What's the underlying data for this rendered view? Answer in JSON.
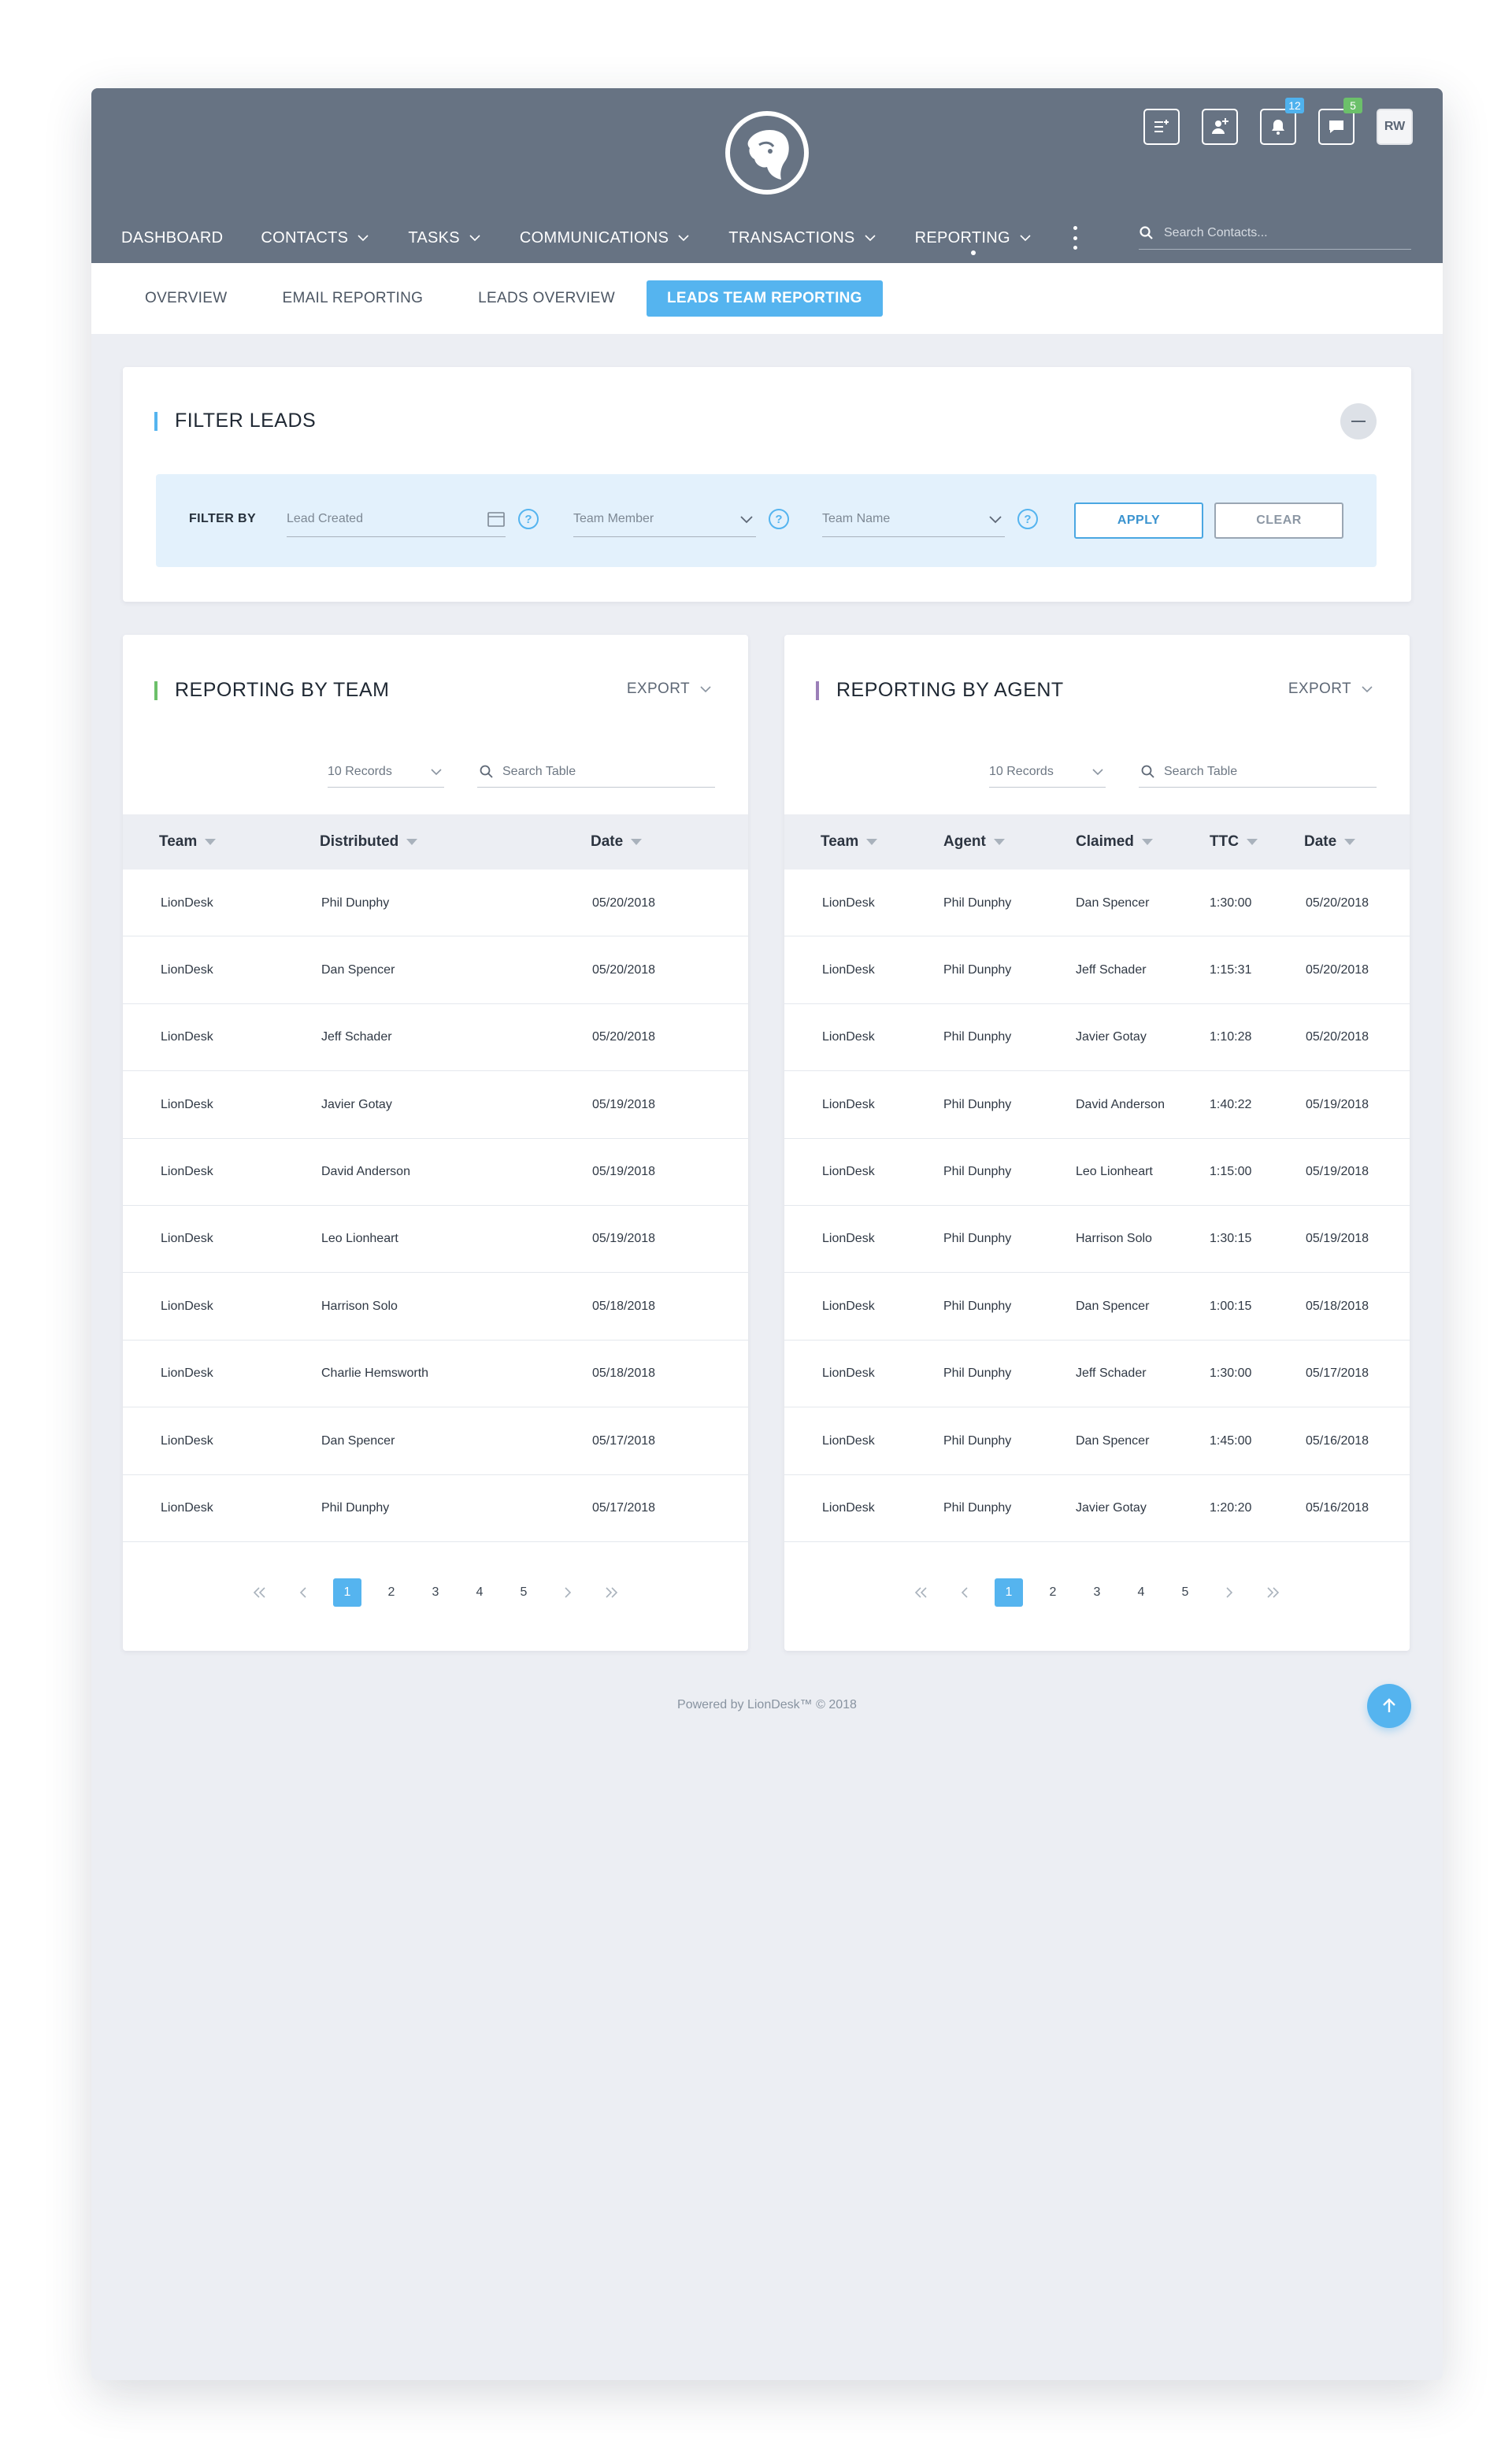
{
  "header": {
    "avatar_initials": "RW",
    "notifications_badge": "12",
    "messages_badge": "5",
    "search_placeholder": "Search Contacts..."
  },
  "nav": {
    "items": [
      {
        "label": "DASHBOARD",
        "has_dropdown": false
      },
      {
        "label": "CONTACTS",
        "has_dropdown": true
      },
      {
        "label": "TASKS",
        "has_dropdown": true
      },
      {
        "label": "COMMUNICATIONS",
        "has_dropdown": true
      },
      {
        "label": "TRANSACTIONS",
        "has_dropdown": true
      },
      {
        "label": "REPORTING",
        "has_dropdown": true,
        "active": true
      }
    ]
  },
  "subnav": {
    "items": [
      {
        "label": "OVERVIEW"
      },
      {
        "label": "EMAIL REPORTING"
      },
      {
        "label": "LEADS OVERVIEW"
      },
      {
        "label": "LEADS TEAM REPORTING",
        "active": true
      }
    ]
  },
  "filter": {
    "title": "FILTER LEADS",
    "filter_by_label": "FILTER BY",
    "lead_created_placeholder": "Lead Created",
    "team_member_placeholder": "Team Member",
    "team_name_placeholder": "Team Name",
    "apply_label": "APPLY",
    "clear_label": "CLEAR",
    "help_glyph": "?"
  },
  "colors": {
    "accent_blue": "#55b4ef",
    "team_bar": "#6cc06a",
    "agent_bar": "#9b7fb8",
    "filter_bar": "#55b4ef",
    "header_bg": "#677383"
  },
  "team_table": {
    "title": "REPORTING BY TEAM",
    "export_label": "EXPORT",
    "records_label": "10 Records",
    "search_placeholder": "Search Table",
    "columns": [
      "Team",
      "Distributed",
      "Date"
    ],
    "rows": [
      [
        "LionDesk",
        "Phil Dunphy",
        "05/20/2018"
      ],
      [
        "LionDesk",
        "Dan Spencer",
        "05/20/2018"
      ],
      [
        "LionDesk",
        "Jeff Schader",
        "05/20/2018"
      ],
      [
        "LionDesk",
        "Javier Gotay",
        "05/19/2018"
      ],
      [
        "LionDesk",
        "David Anderson",
        "05/19/2018"
      ],
      [
        "LionDesk",
        "Leo Lionheart",
        "05/19/2018"
      ],
      [
        "LionDesk",
        "Harrison Solo",
        "05/18/2018"
      ],
      [
        "LionDesk",
        "Charlie Hemsworth",
        "05/18/2018"
      ],
      [
        "LionDesk",
        "Dan Spencer",
        "05/17/2018"
      ],
      [
        "LionDesk",
        "Phil Dunphy",
        "05/17/2018"
      ]
    ],
    "pages": [
      "1",
      "2",
      "3",
      "4",
      "5"
    ],
    "current_page": "1"
  },
  "agent_table": {
    "title": "REPORTING BY AGENT",
    "export_label": "EXPORT",
    "records_label": "10 Records",
    "search_placeholder": "Search Table",
    "columns": [
      "Team",
      "Agent",
      "Claimed",
      "TTC",
      "Date"
    ],
    "rows": [
      [
        "LionDesk",
        "Phil Dunphy",
        "Dan Spencer",
        "1:30:00",
        "05/20/2018"
      ],
      [
        "LionDesk",
        "Phil Dunphy",
        "Jeff Schader",
        "1:15:31",
        "05/20/2018"
      ],
      [
        "LionDesk",
        "Phil Dunphy",
        "Javier Gotay",
        "1:10:28",
        "05/20/2018"
      ],
      [
        "LionDesk",
        "Phil Dunphy",
        "David Anderson",
        "1:40:22",
        "05/19/2018"
      ],
      [
        "LionDesk",
        "Phil Dunphy",
        "Leo Lionheart",
        "1:15:00",
        "05/19/2018"
      ],
      [
        "LionDesk",
        "Phil Dunphy",
        "Harrison Solo",
        "1:30:15",
        "05/19/2018"
      ],
      [
        "LionDesk",
        "Phil Dunphy",
        "Dan Spencer",
        "1:00:15",
        "05/18/2018"
      ],
      [
        "LionDesk",
        "Phil Dunphy",
        "Jeff Schader",
        "1:30:00",
        "05/17/2018"
      ],
      [
        "LionDesk",
        "Phil Dunphy",
        "Dan Spencer",
        "1:45:00",
        "05/16/2018"
      ],
      [
        "LionDesk",
        "Phil Dunphy",
        "Javier Gotay",
        "1:20:20",
        "05/16/2018"
      ]
    ],
    "pages": [
      "1",
      "2",
      "3",
      "4",
      "5"
    ],
    "current_page": "1"
  },
  "footer": {
    "text": "Powered by LionDesk™ © 2018"
  }
}
